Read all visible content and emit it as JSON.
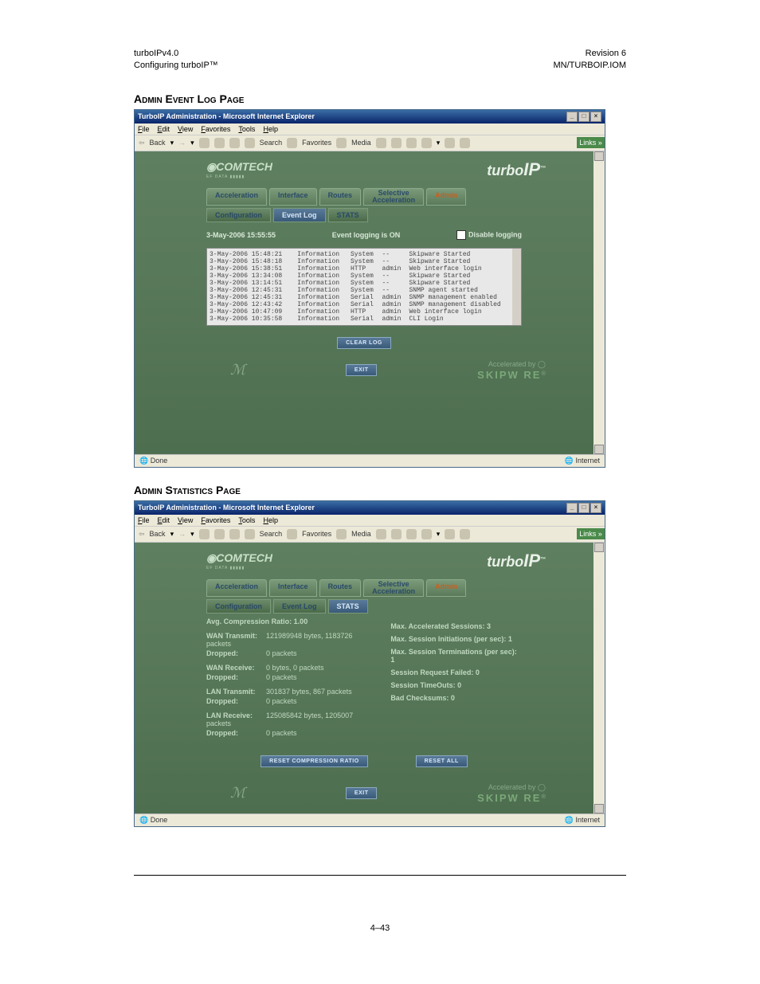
{
  "header": {
    "left_top": "turboIPv4.0",
    "left_bottom": "Configuring turboIP™",
    "right_top": "Revision 6",
    "right_bottom": "MN/TURBOIP.IOM"
  },
  "heading1": "Admin Event Log Page",
  "heading2": "Admin Statistics Page",
  "browser": {
    "title": "TurboIP Administration - Microsoft Internet Explorer",
    "menu": [
      "File",
      "Edit",
      "View",
      "Favorites",
      "Tools",
      "Help"
    ],
    "toolbar": {
      "back": "Back",
      "search": "Search",
      "favorites": "Favorites",
      "media": "Media"
    },
    "links": "Links »",
    "status_done": "Done",
    "status_zone": "Internet"
  },
  "logos": {
    "comtech": "COMTECH",
    "comtech_sub": "EF DATA ▮▮▮▮▮",
    "turbo": "turbo",
    "ip": "IP",
    "tm": "™"
  },
  "tabs": {
    "acceleration": "Acceleration",
    "interface": "Interface",
    "routes": "Routes",
    "selective1": "Selective",
    "selective2": "Acceleration",
    "admin": "Admin"
  },
  "subtabs": {
    "configuration": "Configuration",
    "eventlog": "Event Log",
    "stats": "STATS"
  },
  "eventlog": {
    "timestamp": "3-May-2006 15:55:55",
    "logging_on": "Event logging is ON",
    "disable": "Disable logging",
    "rows": [
      [
        "3-May-2006 15:48:21",
        "Information",
        "System",
        "--",
        "Skipware Started"
      ],
      [
        "3-May-2006 15:48:18",
        "Information",
        "System",
        "--",
        "Skipware Started"
      ],
      [
        "3-May-2006 15:38:51",
        "Information",
        "HTTP",
        "admin",
        "Web interface login"
      ],
      [
        "3-May-2006 13:34:08",
        "Information",
        "System",
        "--",
        "Skipware Started"
      ],
      [
        "3-May-2006 13:14:51",
        "Information",
        "System",
        "--",
        "Skipware Started"
      ],
      [
        "3-May-2006 12:45:31",
        "Information",
        "System",
        "--",
        "SNMP agent started"
      ],
      [
        "3-May-2006 12:45:31",
        "Information",
        "Serial",
        "admin",
        "SNMP management enabled"
      ],
      [
        "3-May-2006 12:43:42",
        "Information",
        "Serial",
        "admin",
        "SNMP management disabled"
      ],
      [
        "3-May-2006 10:47:09",
        "Information",
        "HTTP",
        "admin",
        "Web interface login"
      ],
      [
        "3-May-2006 10:35:58",
        "Information",
        "Serial",
        "admin",
        "CLI Login"
      ]
    ],
    "clear_btn": "CLEAR LOG",
    "exit_btn": "EXIT"
  },
  "skipware": {
    "accel": "Accelerated by",
    "name": "SKIPW  RE",
    "r": "®"
  },
  "stats": {
    "avg": "Avg. Compression Ratio: 1.00",
    "wan_tx_lbl": "WAN Transmit:",
    "wan_tx_val": "121989948 bytes, 1183726 packets",
    "dropped_lbl": "Dropped:",
    "dropped_val": "0 packets",
    "wan_rx_lbl": "WAN Receive:",
    "wan_rx_val": "0 bytes, 0 packets",
    "lan_tx_lbl": "LAN Transmit:",
    "lan_tx_val": "301837 bytes, 867 packets",
    "lan_rx_lbl": "LAN Receive:",
    "lan_rx_val": "125085842 bytes, 1205007 packets",
    "right": [
      "Max. Accelerated Sessions: 3",
      "Max. Session Initiations (per sec): 1",
      "Max. Session Terminations (per sec): 1",
      "Session Request Failed: 0",
      "Session TimeOuts: 0",
      "Bad Checksums: 0"
    ],
    "reset_ratio": "RESET COMPRESSION RATIO",
    "reset_all": "RESET ALL"
  },
  "pagenum": "4–43"
}
